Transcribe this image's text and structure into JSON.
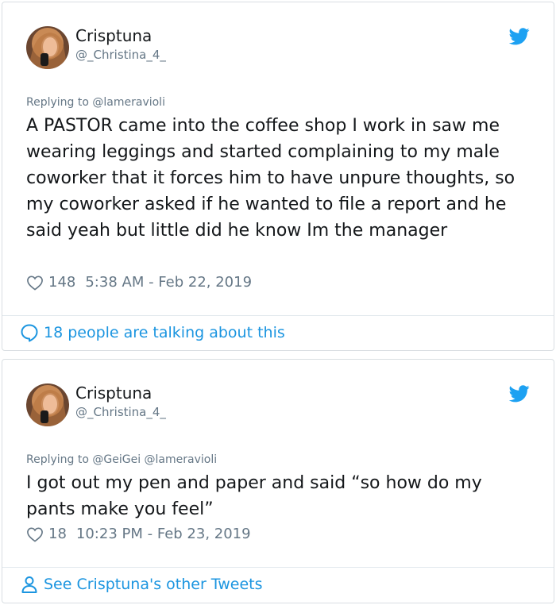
{
  "tweets": [
    {
      "name": "Crisptuna",
      "handle": "@_Christina_4_",
      "replying_prefix": "Replying to ",
      "replying_to": "@lameravioli",
      "text": "A PASTOR came into the coffee shop I work in saw me wearing leggings and started complaining to my male coworker that it forces him to have unpure thoughts, so my coworker asked if he wanted to file a report and he said yeah but little did he know Im the manager",
      "likes": "148",
      "timestamp": "5:38 AM - Feb 22, 2019",
      "footer": "18 people are talking about this",
      "footer_icon": "speech-bubble-icon"
    },
    {
      "name": "Crisptuna",
      "handle": "@_Christina_4_",
      "replying_prefix": "Replying to ",
      "replying_to": "@GeiGei @lameravioli",
      "text": "I got out my pen and paper and said “so how do my pants make you feel”",
      "likes": "18",
      "timestamp": "10:23 PM - Feb 23, 2019",
      "footer": "See Crisptuna's other Tweets",
      "footer_icon": "person-icon"
    }
  ],
  "colors": {
    "text": "#14171a",
    "muted": "#657786",
    "link": "#1b95e0",
    "twitter_blue": "#1da1f2",
    "border": "#d9dee2"
  }
}
